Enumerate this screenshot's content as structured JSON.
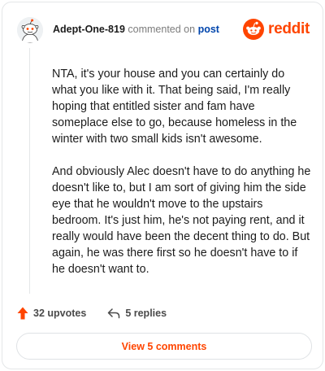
{
  "comment": {
    "author": "Adept-One-819",
    "commented_on_text": "commented on",
    "post_link_text": "post",
    "paragraphs": [
      "NTA, it's your house and you can certainly do what you like with it. That being said, I'm really hoping that entitled sister and fam have someplace else to go, because homeless in the winter with two small kids isn't awesome.",
      "And obviously Alec doesn't have to do anything he doesn't like to, but I am sort of giving him the side eye that he wouldn't move to the upstairs bedroom. It's just him, he's not paying rent, and it really would have been the decent thing to do. But again, he was there first so he doesn't have to if he doesn't want to."
    ]
  },
  "brand": {
    "wordmark": "reddit",
    "color": "#ff4500",
    "icon": "reddit-snoo-icon"
  },
  "actions": {
    "upvotes_label": "32 upvotes",
    "upvote_icon": "upvote-arrow-icon",
    "replies_label": "5 replies",
    "reply_icon": "reply-arrow-icon"
  },
  "footer": {
    "view_comments_label": "View 5 comments"
  },
  "colors": {
    "accent": "#ff4500",
    "link": "#0045ac",
    "muted": "#7c7c7c",
    "border": "#e4e6e8"
  }
}
